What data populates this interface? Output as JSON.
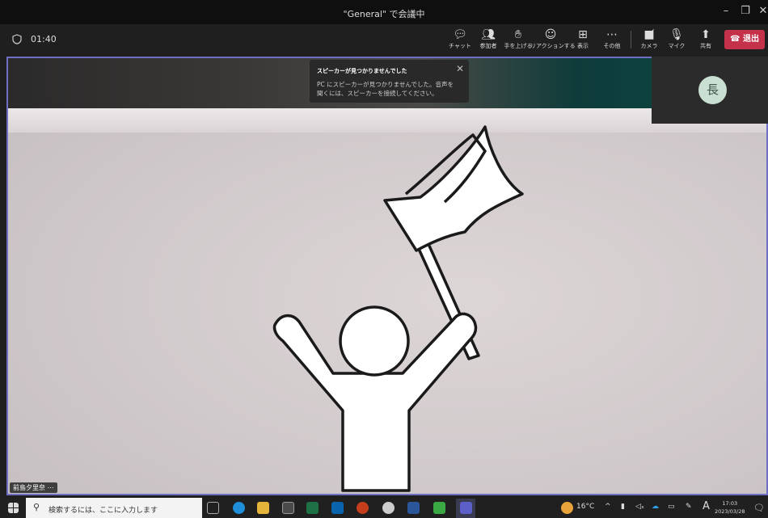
{
  "window": {
    "title": "\"General\" で会議中"
  },
  "meeting": {
    "timer": "01:40"
  },
  "toolbar": {
    "chat": "チャット",
    "participants": "参加者",
    "raise_hand": "手を上げる",
    "reactions": "リアクションする",
    "view": "表示",
    "more": "その他",
    "camera": "カメラ",
    "mic": "マイク",
    "share": "共有",
    "leave": "退出"
  },
  "toast": {
    "title": "スピーカーが見つかりませんでした",
    "body": "PC にスピーカーが見つかりませんでした。音声を聞くには、スピーカーを接続してください。"
  },
  "participant": {
    "name": "前島夕里奈 ⋯",
    "avatar_initial": "長"
  },
  "taskbar": {
    "search_placeholder": "検索するには、ここに入力します",
    "weather": "16°C",
    "ime": "A",
    "time": "17:03",
    "date": "2023/03/28"
  },
  "colors": {
    "accent": "#6f6fc4",
    "leave": "#c4314b",
    "avatar_bg": "#c8dfd1"
  }
}
